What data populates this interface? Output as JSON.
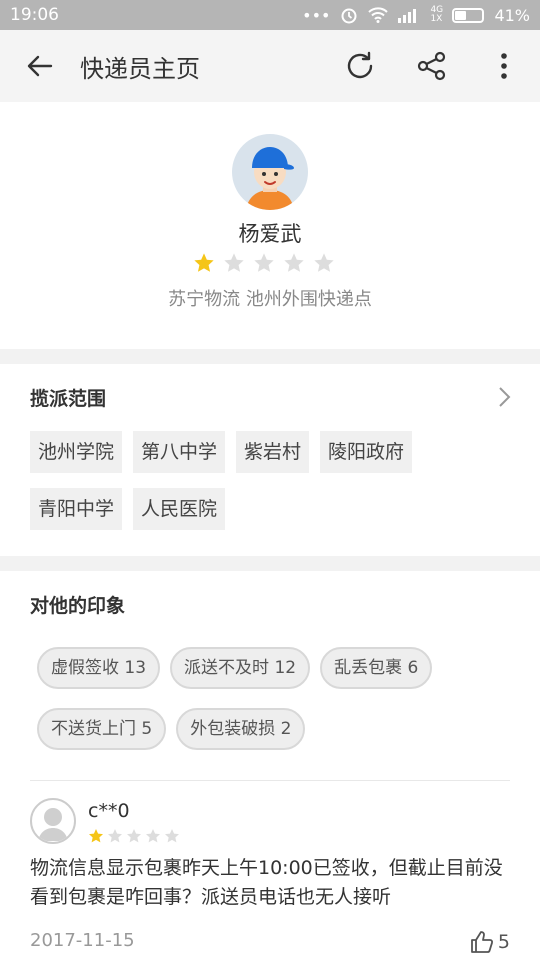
{
  "status_bar": {
    "time": "19:06",
    "network": "4G 1X",
    "battery": "41%",
    "battery_level": 0.41
  },
  "header": {
    "title": "快递员主页",
    "icons": [
      "back-arrow-icon",
      "refresh-icon",
      "share-icon",
      "more-icon"
    ]
  },
  "courier": {
    "name": "杨爱武",
    "rating": 1,
    "max_rating": 5,
    "company": "苏宁物流 池州外围快递点"
  },
  "scope": {
    "title": "揽派范围",
    "areas": [
      "池州学院",
      "第八中学",
      "紫岩村",
      "陵阳政府",
      "青阳中学",
      "人民医院"
    ]
  },
  "impressions": {
    "title": "对他的印象",
    "tags": [
      "虚假签收 13",
      "派送不及时 12",
      "乱丢包裹 6",
      "不送货上门 5",
      "外包装破损 2"
    ]
  },
  "review": {
    "user": "c**0",
    "rating": 1,
    "text": "物流信息显示包裹昨天上午10:00已签收，但截止目前没看到包裹是咋回事？派送员电话也无人接听",
    "date": "2017-11-15",
    "likes": "5"
  },
  "colors": {
    "star_on": "#f5c518",
    "star_off": "#dddddd",
    "status_bar": "#b5b5b5",
    "avatar_cap": "#1e6fd9",
    "avatar_shirt": "#f28a2e"
  }
}
